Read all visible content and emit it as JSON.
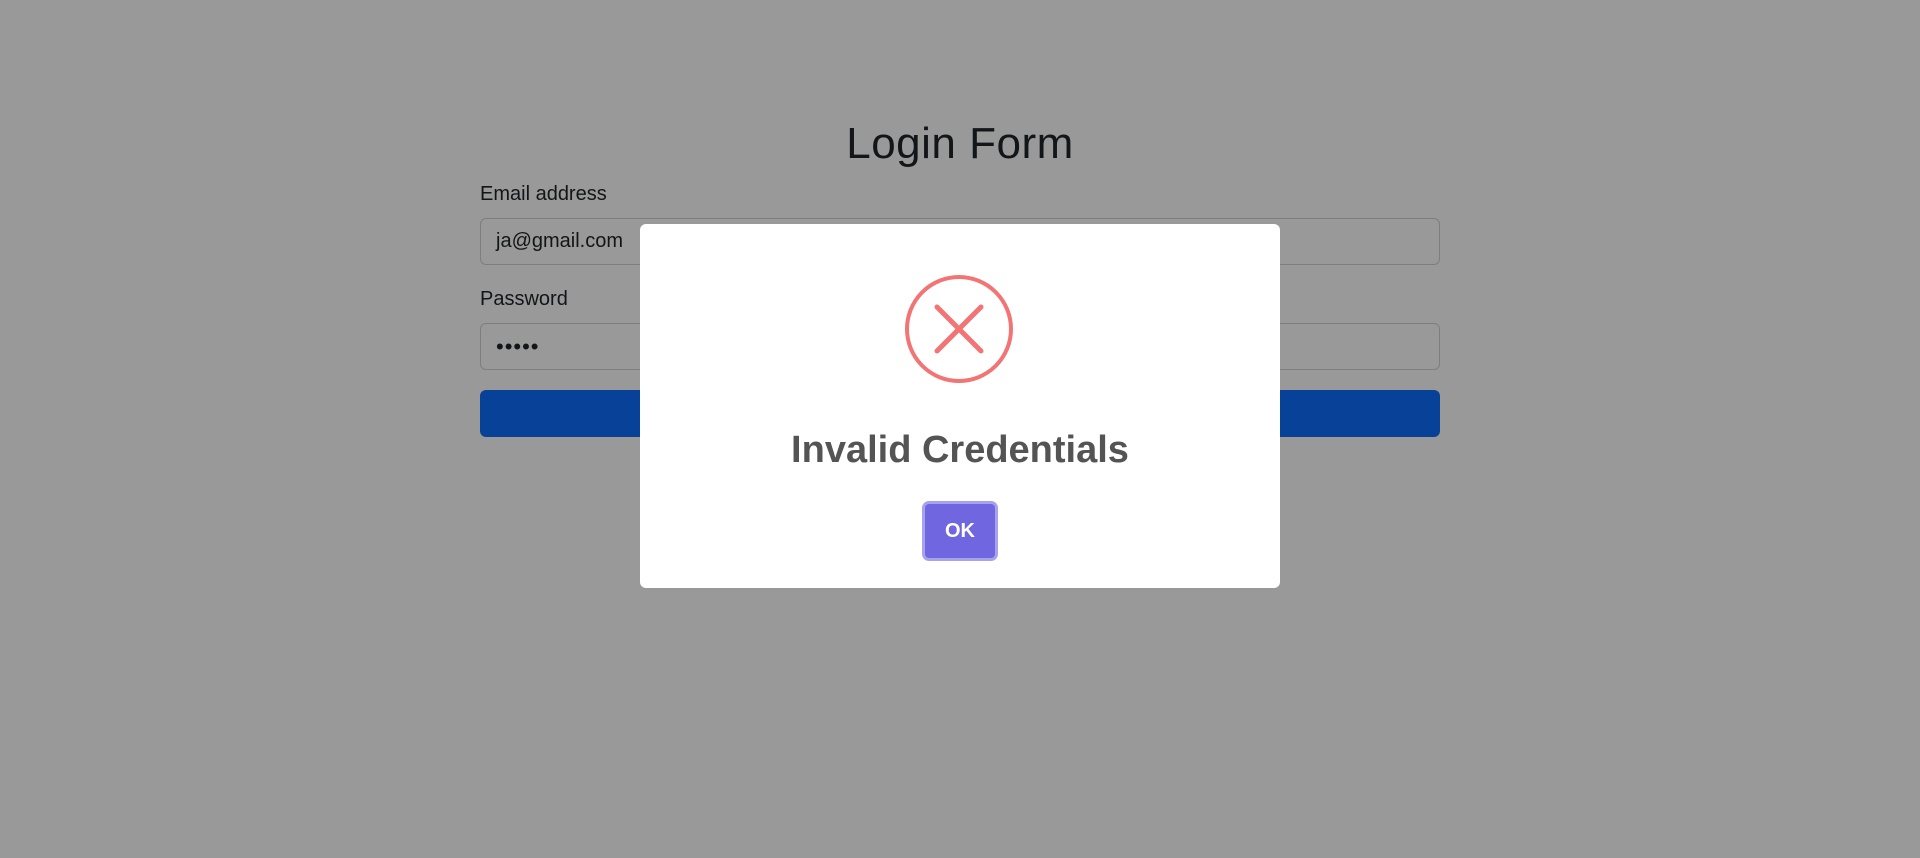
{
  "login_form": {
    "title": "Login Form",
    "email_label": "Email address",
    "email_value": "ja@gmail.com",
    "password_label": "Password",
    "password_value": "•••••",
    "submit_label": ""
  },
  "dialog": {
    "icon": "error-x-icon",
    "title": "Invalid Credentials",
    "ok_label": "OK"
  },
  "colors": {
    "primary_button": "#0d6efd",
    "error_icon": "#f27474",
    "confirm_button": "#7066e0",
    "overlay": "rgba(0,0,0,0.4)"
  }
}
